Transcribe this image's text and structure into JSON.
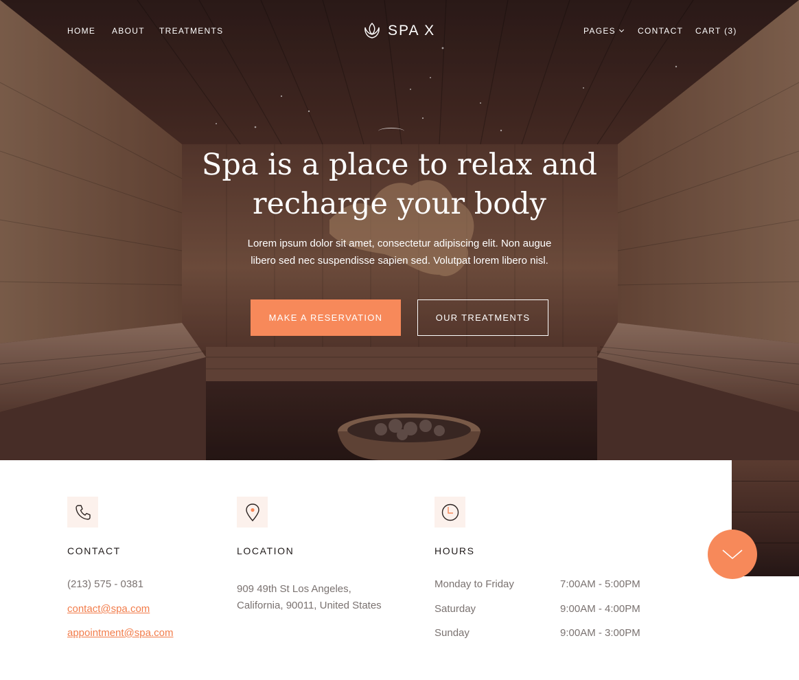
{
  "nav": {
    "left": [
      "HOME",
      "ABOUT",
      "TREATMENTS"
    ],
    "logo_text": "SPA X",
    "pages_label": "PAGES",
    "contact_label": "CONTACT",
    "cart_label": "CART (3)"
  },
  "hero": {
    "title_line1": "Spa is a place to relax and",
    "title_line2": "recharge your body",
    "subtitle_line1": "Lorem ipsum dolor sit amet, consectetur adipiscing elit. Non augue",
    "subtitle_line2": "libero sed nec suspendisse sapien sed. Volutpat lorem libero nisl.",
    "primary_button": "MAKE A RESERVATION",
    "secondary_button": "OUR TREATMENTS"
  },
  "info": {
    "contact": {
      "heading": "CONTACT",
      "icon": "phone-icon",
      "phone": "(213) 575 - 0381",
      "email_1": "contact@spa.com",
      "email_2": "appointment@spa.com"
    },
    "location": {
      "heading": "LOCATION",
      "icon": "map-pin-icon",
      "address_line1": "909 49th St Los Angeles,",
      "address_line2": "California, 90011, United States"
    },
    "hours": {
      "heading": "HOURS",
      "icon": "clock-icon",
      "rows": [
        {
          "day": "Monday to Friday",
          "time": "7:00AM - 5:00PM"
        },
        {
          "day": "Saturday",
          "time": "9:00AM - 4:00PM"
        },
        {
          "day": "Sunday",
          "time": "9:00AM - 3:00PM"
        }
      ]
    }
  },
  "colors": {
    "accent": "#f7895a",
    "link": "#f27c4a",
    "icon_bg": "#fcf1ec"
  },
  "scroll_button_icon": "chevron-down-icon"
}
